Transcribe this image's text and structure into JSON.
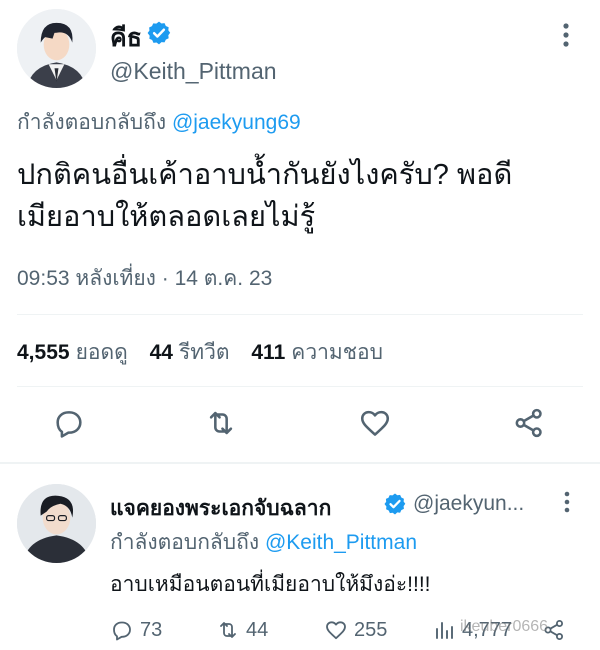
{
  "main_tweet": {
    "display_name": "คีธ",
    "handle": "@Keith_Pittman",
    "replying_prefix": "กำลังตอบกลับถึง",
    "replying_to": "@jaekyung69",
    "text_line1": "ปกติคนอื่นเค้าอาบน้ำกันยังไงครับ? พอดี",
    "text_line2": "เมียอาบให้ตลอดเลยไม่รู้",
    "timestamp": "09:53 หลังเที่ยง · 14 ต.ค. 23",
    "stats": {
      "views_count": "4,555",
      "views_label": "ยอดดู",
      "retweets_count": "44",
      "retweets_label": "รีทวีต",
      "likes_count": "411",
      "likes_label": "ความชอบ"
    },
    "icons": {
      "reply": "reply-icon",
      "retweet": "retweet-icon",
      "like": "heart-icon",
      "share": "share-icon"
    }
  },
  "reply_tweet": {
    "display_name": "แจคยองพระเอกจับฉลาก",
    "handle": "@jaekyun...",
    "replying_prefix": "กำลังตอบกลับถึง",
    "replying_to": "@Keith_Pittman",
    "text": "อาบเหมือนตอนที่เมียอาบให้มึงอ่ะ!!!!",
    "replies": "73",
    "retweets": "44",
    "likes": "255",
    "views": "4,777"
  },
  "watermark": "ikeuber0666",
  "colors": {
    "accent": "#1d9bf0",
    "text_primary": "#0f1419",
    "text_secondary": "#536471",
    "divider": "#eff3f4"
  }
}
